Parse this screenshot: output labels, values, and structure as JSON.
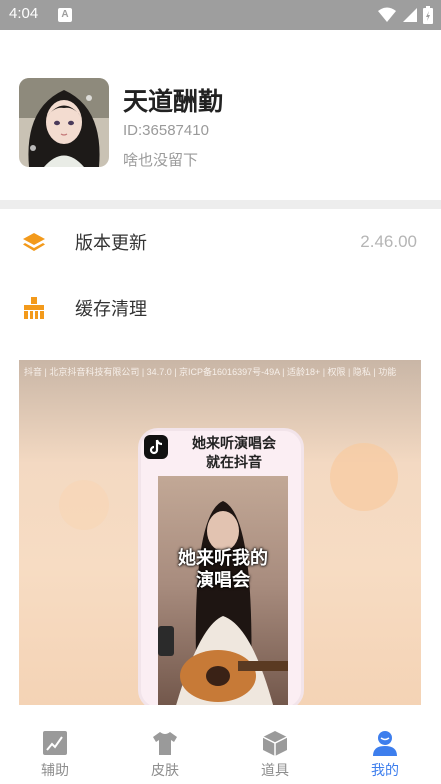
{
  "status_bar": {
    "time": "4:04",
    "notification_letter": "A"
  },
  "profile": {
    "name": "天道酬勤",
    "id_text": "ID:36587410",
    "bio": "啥也没留下"
  },
  "menu": {
    "items": [
      {
        "label": "版本更新",
        "value": "2.46.00",
        "icon": "layers-icon"
      },
      {
        "label": "缓存清理",
        "value": "",
        "icon": "broom-icon"
      }
    ]
  },
  "ad": {
    "disclaimer": "抖音 | 北京抖音科技有限公司 | 34.7.0 | 京ICP备16016397号-49A | 适龄18+ | 权限 | 隐私 | 功能",
    "headline_line1": "她来听演唱会",
    "headline_line2": "就在抖音",
    "video_caption_line1": "她来听我的",
    "video_caption_line2": "演唱会"
  },
  "bottom_nav": {
    "items": [
      {
        "label": "辅助",
        "icon": "image-icon",
        "active": false
      },
      {
        "label": "皮肤",
        "icon": "tshirt-icon",
        "active": false
      },
      {
        "label": "道具",
        "icon": "box-icon",
        "active": false
      },
      {
        "label": "我的",
        "icon": "user-icon",
        "active": true
      }
    ]
  },
  "colors": {
    "accent": "#3d7eed",
    "menu_icon": "#f39a1b",
    "inactive_nav": "#8e8e8e",
    "status_bar": "#9e9e9e"
  }
}
